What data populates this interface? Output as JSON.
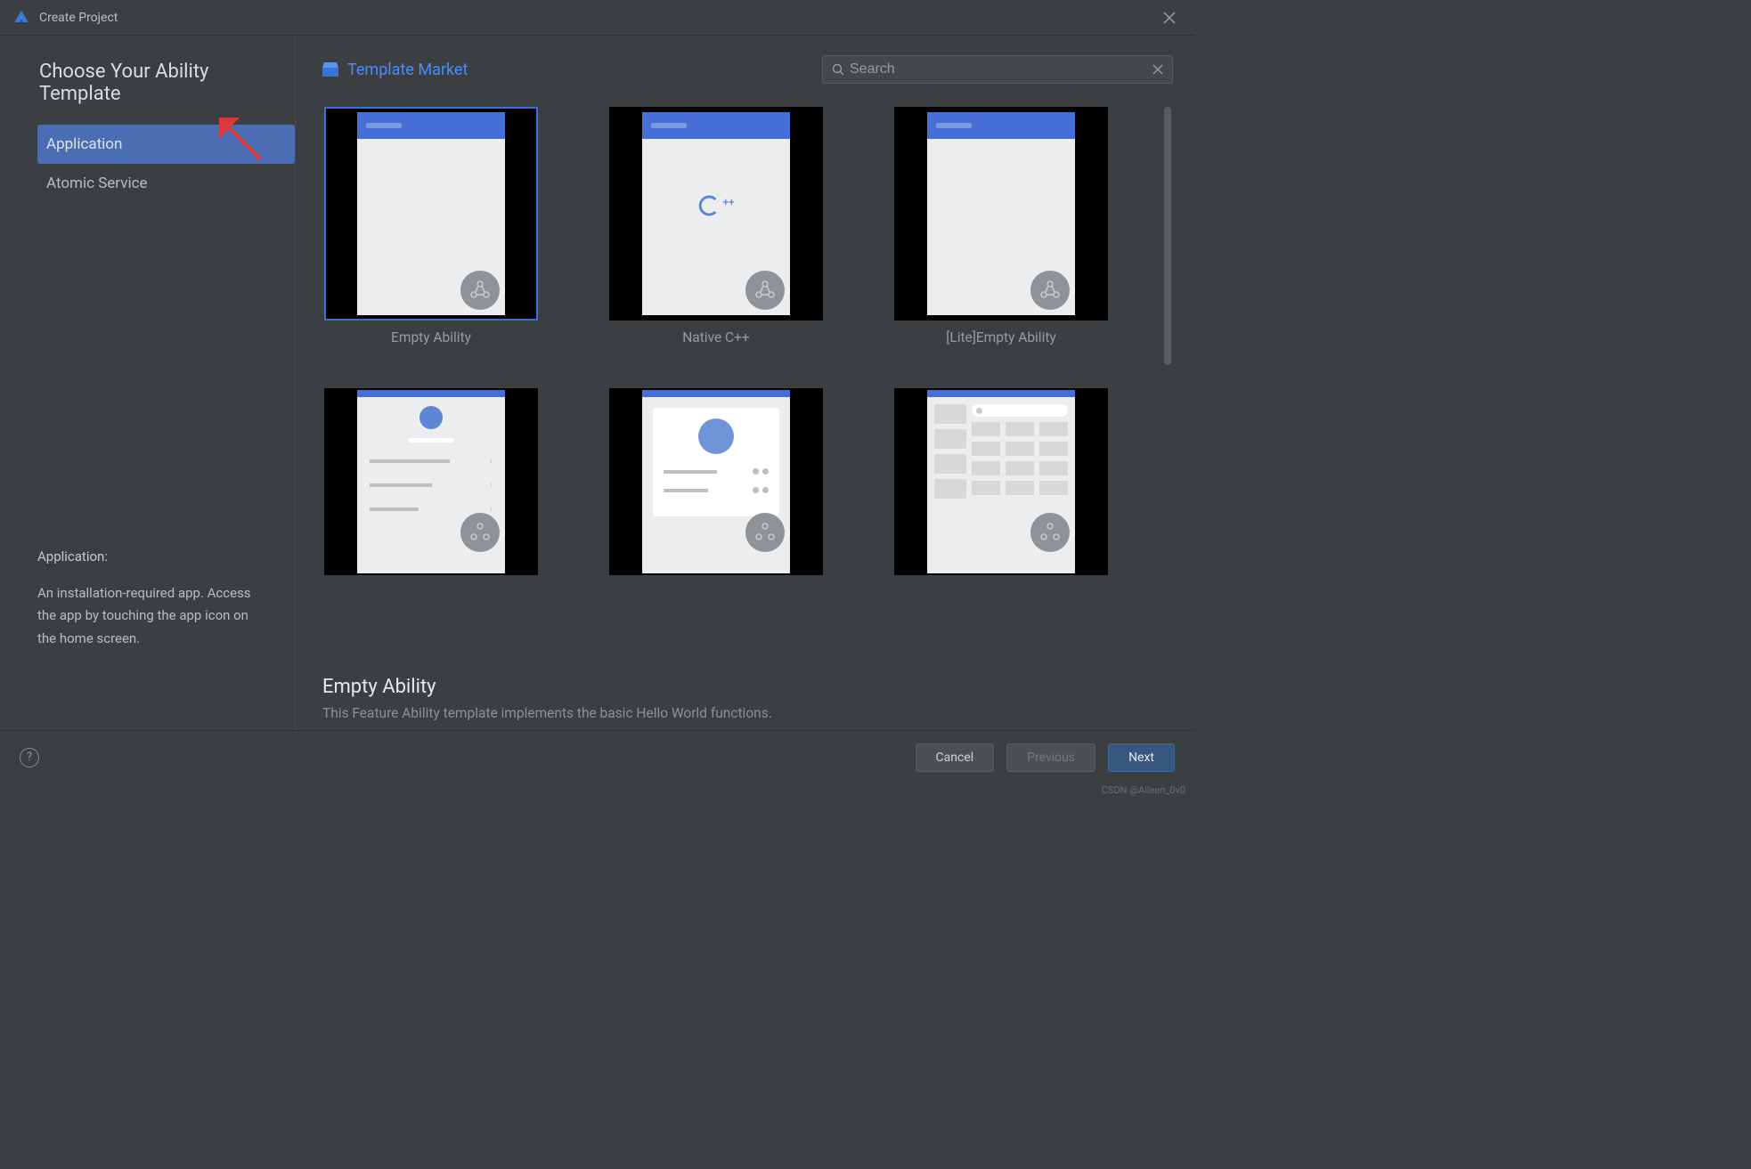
{
  "window": {
    "title": "Create Project"
  },
  "page": {
    "title": "Choose Your Ability Template"
  },
  "sidebar": {
    "items": [
      {
        "label": "Application",
        "selected": true
      },
      {
        "label": "Atomic Service",
        "selected": false
      }
    ]
  },
  "sidebar_help": {
    "title": "Application:",
    "desc": "An installation-required app. Access the app by touching the app icon on the home screen."
  },
  "right_header": {
    "market_label": "Template Market",
    "search_placeholder": "Search"
  },
  "templates": [
    {
      "label": "Empty Ability",
      "selected": true,
      "kind": "empty"
    },
    {
      "label": "Native C++",
      "selected": false,
      "kind": "cpp"
    },
    {
      "label": "[Lite]Empty Ability",
      "selected": false,
      "kind": "empty"
    },
    {
      "label": "",
      "selected": false,
      "kind": "profile"
    },
    {
      "label": "",
      "selected": false,
      "kind": "list"
    },
    {
      "label": "",
      "selected": false,
      "kind": "grid"
    }
  ],
  "detail": {
    "title": "Empty Ability",
    "desc": "This Feature Ability template implements the basic Hello World functions."
  },
  "footer": {
    "cancel": "Cancel",
    "previous": "Previous",
    "next": "Next"
  },
  "watermark": "CSDN @Aileen_0v0"
}
